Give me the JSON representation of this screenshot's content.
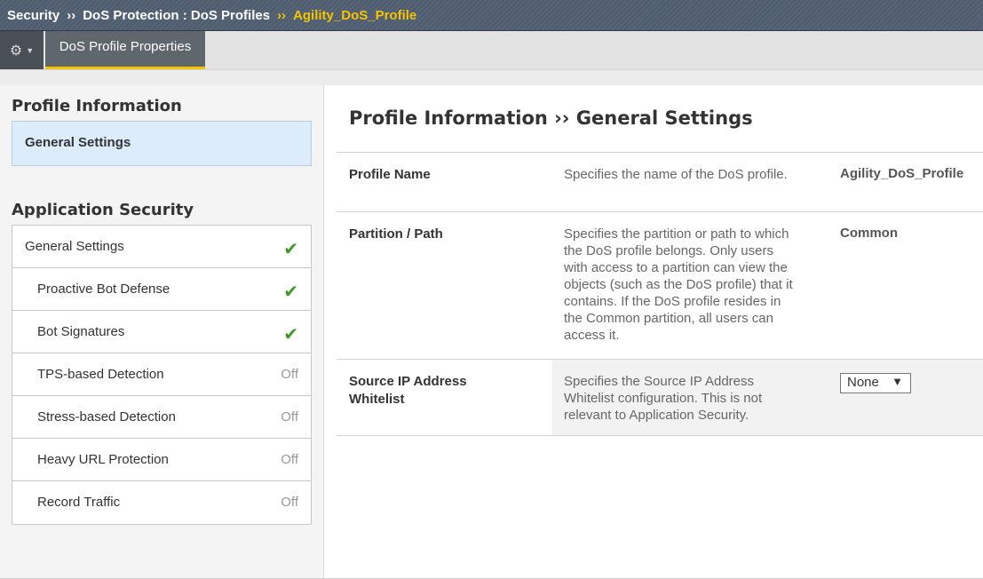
{
  "breadcrumb": {
    "items": [
      "Security",
      "DoS Protection : DoS Profiles"
    ],
    "separator": "››",
    "current": "Agility_DoS_Profile"
  },
  "toolbar": {
    "gear_icon": "⚙",
    "caret_icon": "▼",
    "active_tab": "DoS Profile Properties"
  },
  "sidebar": {
    "profile_info_heading": "Profile Information",
    "profile_info_item": "General Settings",
    "app_security_heading": "Application Security",
    "items": [
      {
        "label": "General Settings",
        "status": "✔"
      },
      {
        "label": "Proactive Bot Defense",
        "status": "✔"
      },
      {
        "label": "Bot Signatures",
        "status": "✔"
      },
      {
        "label": "TPS-based Detection",
        "status": "Off"
      },
      {
        "label": "Stress-based Detection",
        "status": "Off"
      },
      {
        "label": "Heavy URL Protection",
        "status": "Off"
      },
      {
        "label": "Record Traffic",
        "status": "Off"
      }
    ]
  },
  "main": {
    "title": "Profile Information ›› General Settings",
    "rows": [
      {
        "name": "Profile Name",
        "description": "Specifies the name of the DoS profile.",
        "value": "Agility_DoS_Profile"
      },
      {
        "name": "Partition / Path",
        "description": "Specifies the partition or path to which the DoS profile belongs. Only users with access to a partition can view the objects (such as the DoS profile) that it contains. If the DoS profile resides in the Common partition, all users can access it.",
        "value": "Common"
      },
      {
        "name": "Source IP Address Whitelist",
        "description": "Specifies the Source IP Address Whitelist configuration. This is not relevant to Application Security.",
        "value": "None",
        "arrow": "▼"
      }
    ]
  },
  "colors": {
    "accent": "#f5c400",
    "check": "#3b9b22",
    "selected_bg": "#dcecfb"
  }
}
